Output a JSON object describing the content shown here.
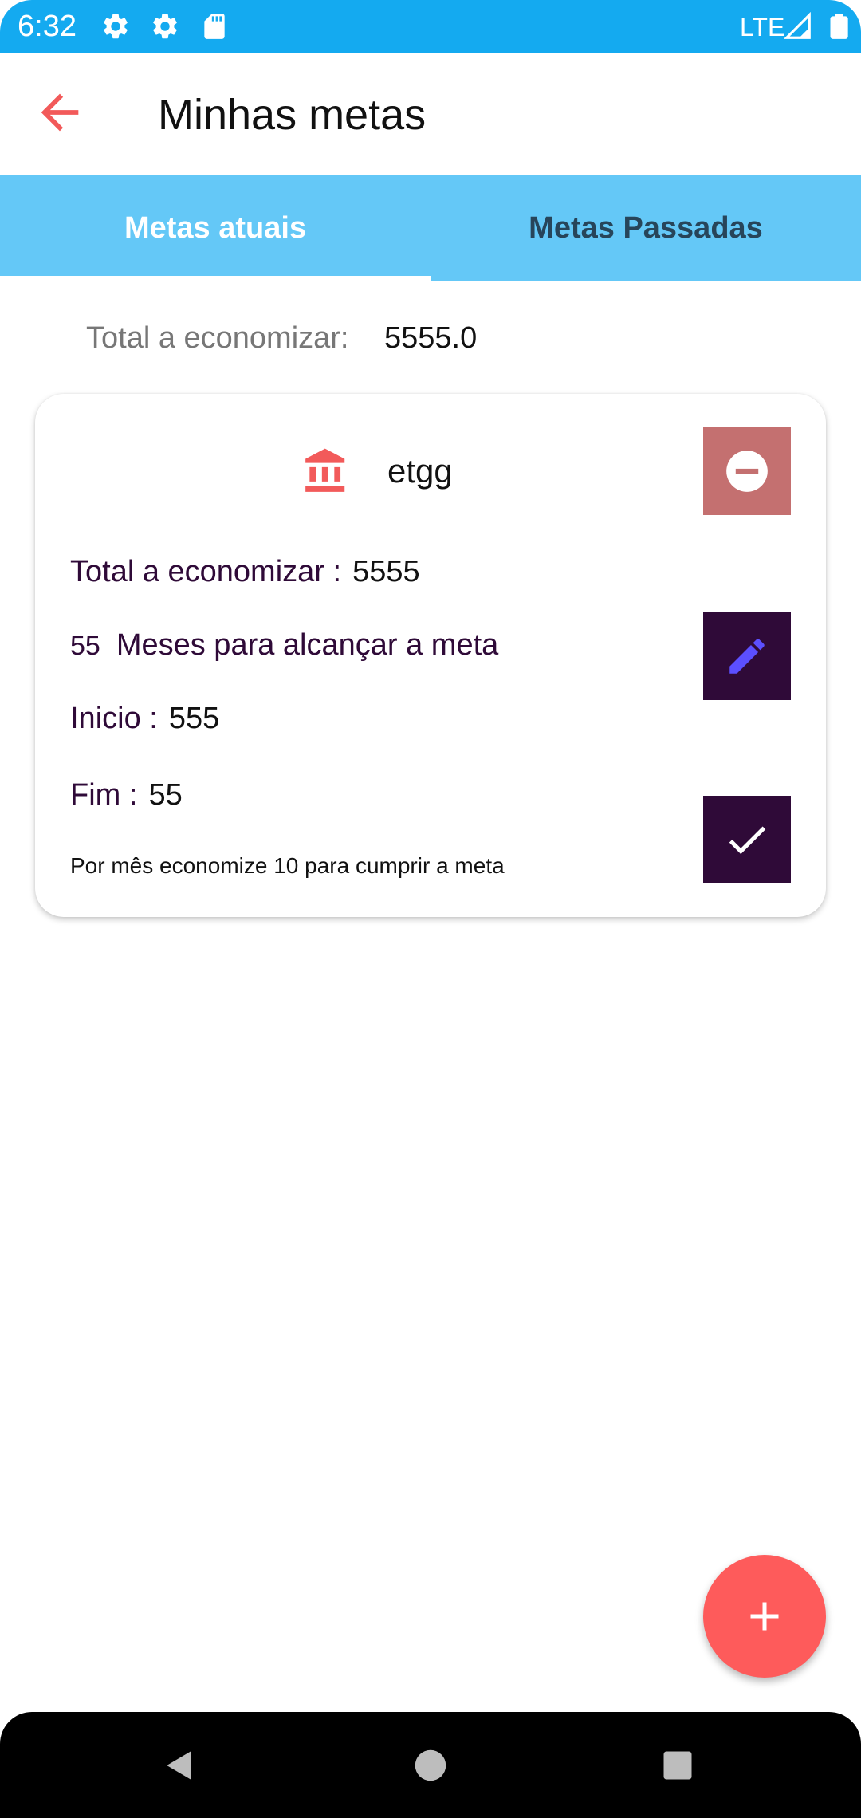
{
  "status_bar": {
    "time": "6:32",
    "network": "LTE",
    "background_color": "#14aaf0",
    "icons": [
      "settings-icon",
      "settings-icon",
      "sd-card-icon",
      "signal-icon",
      "battery-icon"
    ]
  },
  "app_bar": {
    "title": "Minhas metas",
    "back_icon": "arrow-back-icon",
    "accent_color": "#f25a5a"
  },
  "tabs": [
    {
      "label": "Metas atuais",
      "selected": true
    },
    {
      "label": "Metas Passadas",
      "selected": false
    }
  ],
  "summary": {
    "label": "Total a economizar:",
    "value": "5555.0"
  },
  "goal_card": {
    "icon": "bank-icon",
    "name": "etgg",
    "total_label": "Total a economizar :",
    "total_value": "5555",
    "months_value": "55",
    "months_label": "Meses para alcançar a meta",
    "inicio_label": "Inicio :",
    "inicio_value": "555",
    "fim_label": "Fim :",
    "fim_value": "55",
    "monthly_text": "Por mês economize  10 para cumprir a meta",
    "actions": {
      "delete_icon": "remove-circle-icon",
      "edit_icon": "pencil-icon",
      "complete_icon": "check-icon"
    }
  },
  "fab": {
    "icon": "plus-icon",
    "color": "#fe5b5b"
  },
  "nav_bar": {
    "icons": [
      "back-triangle-icon",
      "home-circle-icon",
      "recents-square-icon"
    ]
  }
}
